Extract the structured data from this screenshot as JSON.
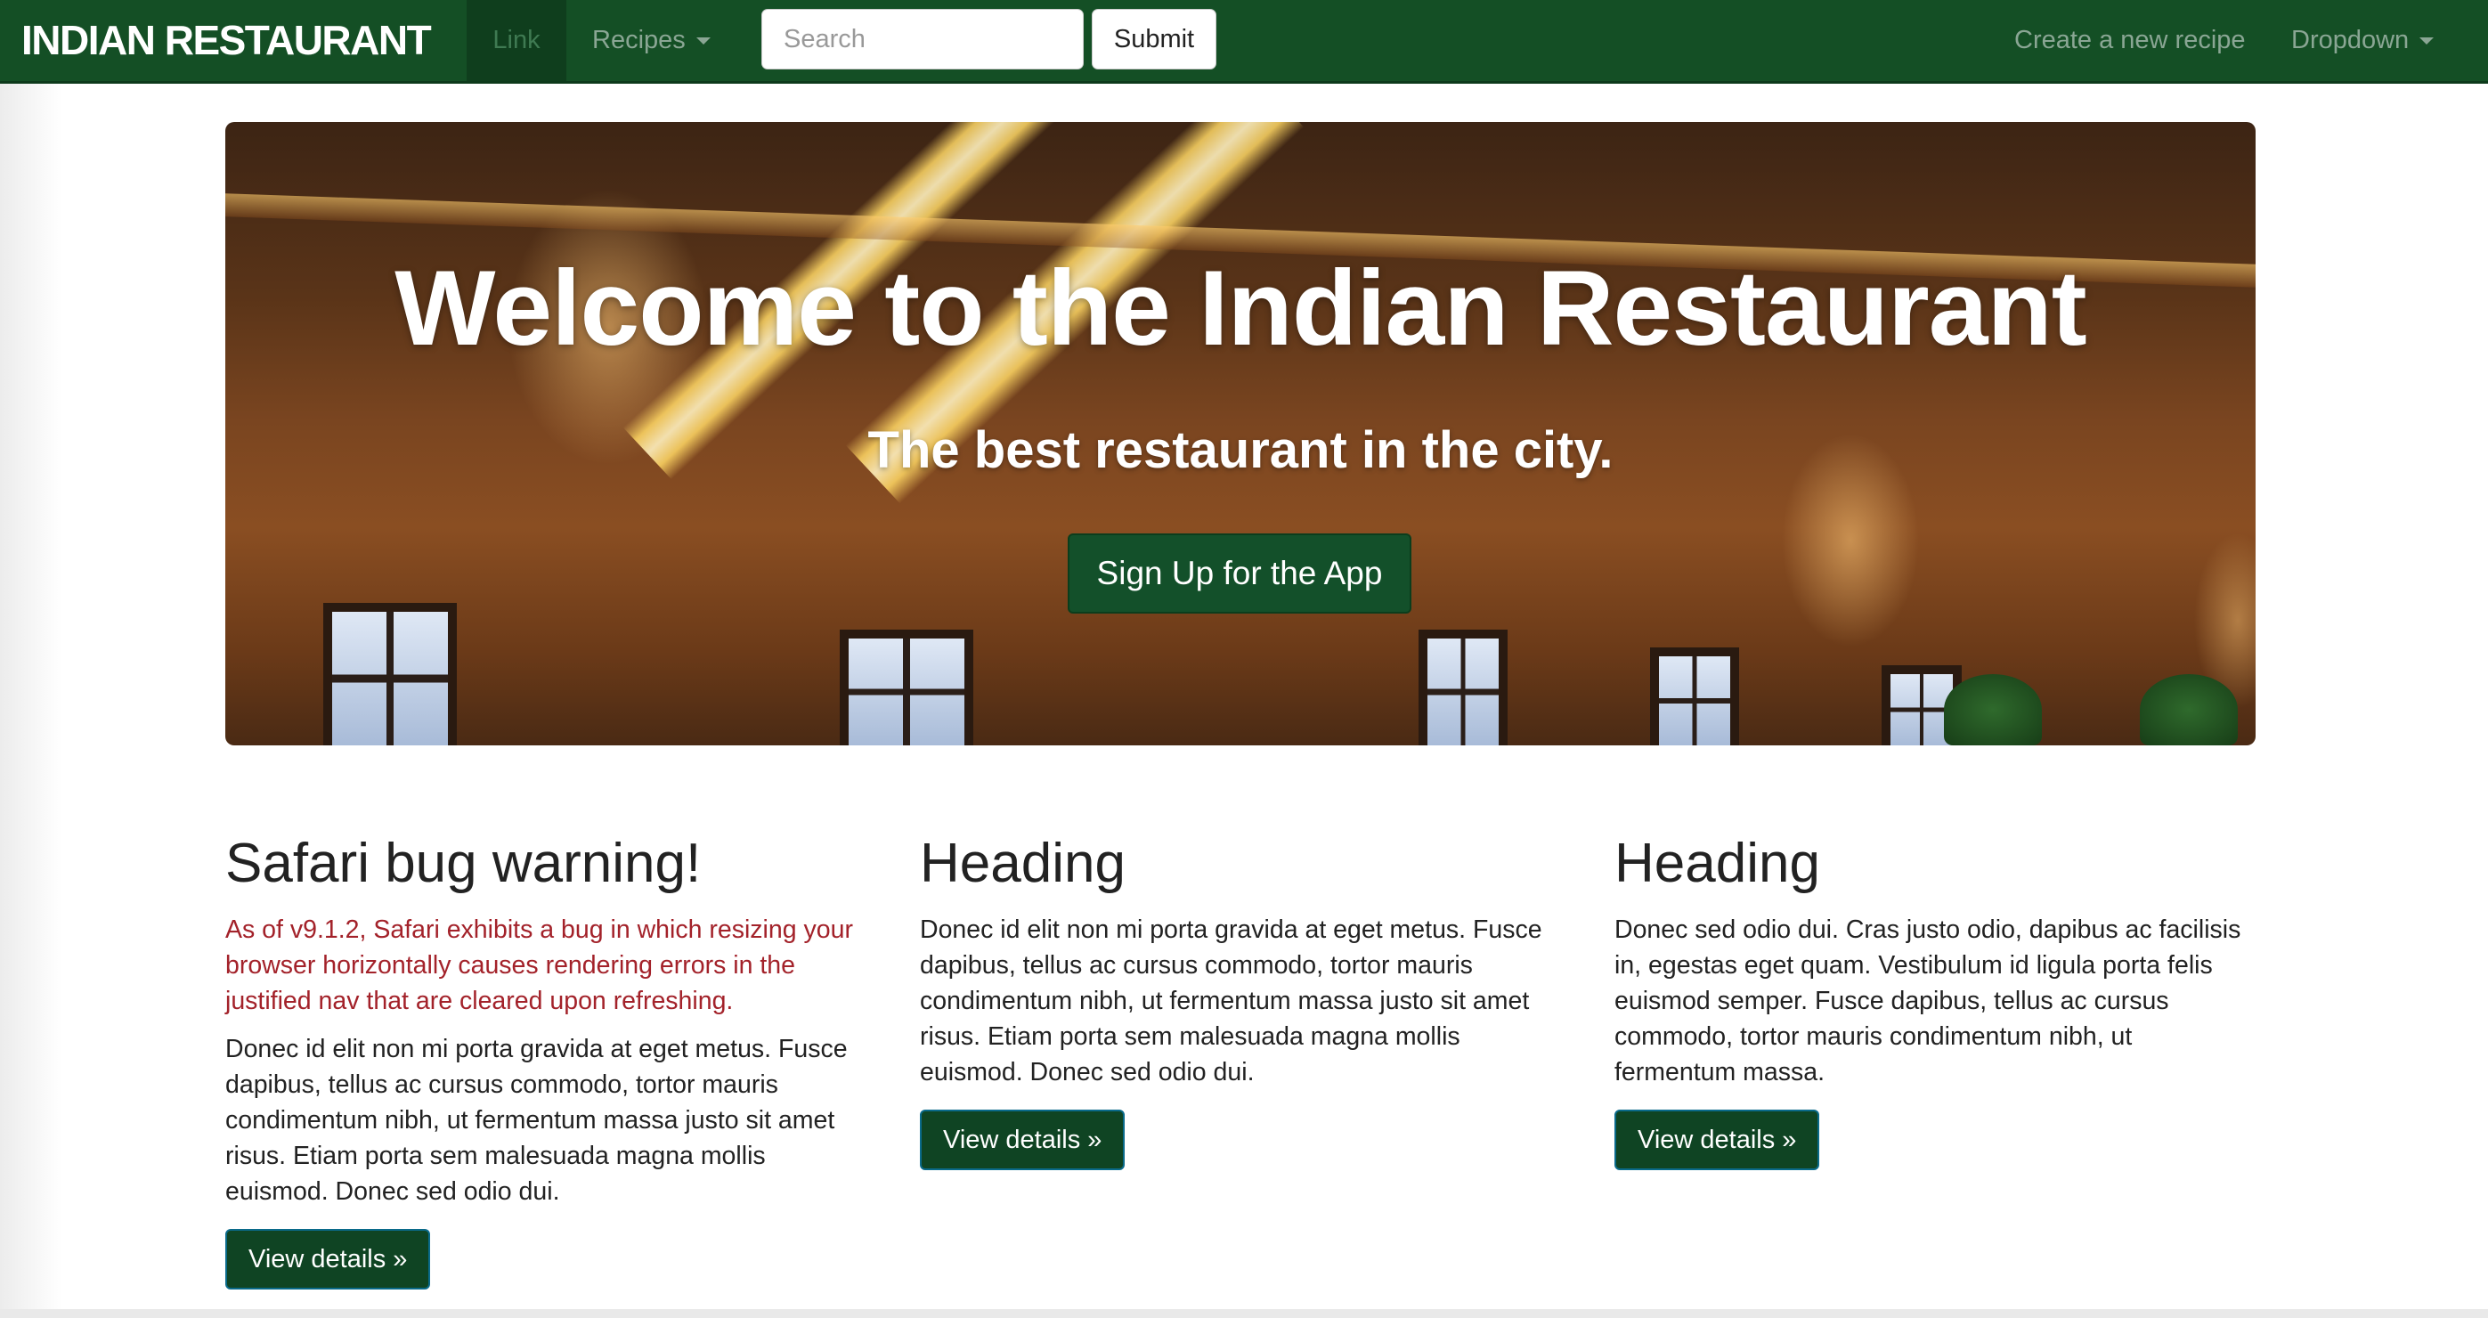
{
  "navbar": {
    "brand": "INDIAN RESTAURANT",
    "link_label": "Link",
    "recipes_label": "Recipes",
    "search_placeholder": "Search",
    "submit_label": "Submit",
    "create_recipe_label": "Create a new recipe",
    "dropdown_label": "Dropdown",
    "bg_color": "#144f25"
  },
  "hero": {
    "title": "Welcome to the Indian Restaurant",
    "subtitle": "The best restaurant in the city.",
    "button_label": "Sign Up for the App"
  },
  "columns": [
    {
      "heading": "Safari bug warning!",
      "warning": "As of v9.1.2, Safari exhibits a bug in which resizing your browser horizontally causes rendering errors in the justified nav that are cleared upon refreshing.",
      "body": "Donec id elit non mi porta gravida at eget metus. Fusce dapibus, tellus ac cursus commodo, tortor mauris condimentum nibh, ut fermentum massa justo sit amet risus. Etiam porta sem malesuada magna mollis euismod. Donec sed odio dui.",
      "button_label": "View details »"
    },
    {
      "heading": "Heading",
      "body": "Donec id elit non mi porta gravida at eget metus. Fusce dapibus, tellus ac cursus commodo, tortor mauris condimentum nibh, ut fermentum massa justo sit amet risus. Etiam porta sem malesuada magna mollis euismod. Donec sed odio dui.",
      "button_label": "View details »"
    },
    {
      "heading": "Heading",
      "body": "Donec sed odio dui. Cras justo odio, dapibus ac facilisis in, egestas eget quam. Vestibulum id ligula porta felis euismod semper. Fusce dapibus, tellus ac cursus commodo, tortor mauris condimentum nibh, ut fermentum massa.",
      "button_label": "View details »"
    }
  ],
  "colors": {
    "warning_text": "#a3222a",
    "button_green": "#0f4423"
  }
}
